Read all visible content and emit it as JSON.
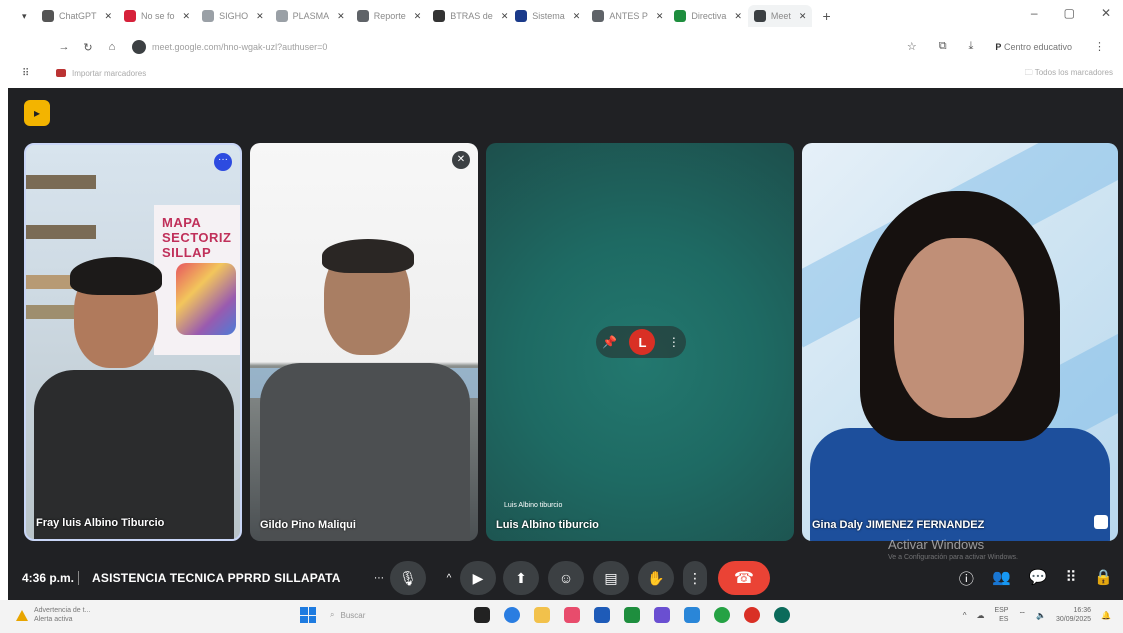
{
  "browser": {
    "tabs": [
      {
        "label": "ChatGPT",
        "color": "#555555"
      },
      {
        "label": "No se fo",
        "color": "#d6213a"
      },
      {
        "label": "SIGHO",
        "color": "#9aa0a6"
      },
      {
        "label": "PLASMA",
        "color": "#9aa0a6"
      },
      {
        "label": "Reporte",
        "color": "#5f6368"
      },
      {
        "label": "BTRAS de",
        "color": "#333333"
      },
      {
        "label": "Sistema",
        "color": "#1a3a8a"
      },
      {
        "label": "ANTES P",
        "color": "#5f6368"
      },
      {
        "label": "Directiva",
        "color": "#1e8e3e"
      },
      {
        "label": "Meet",
        "color": "#3c4043"
      }
    ],
    "url": "meet.google.com/hno-wgak-uzl?authuser=0",
    "profile_label": "Centro educativo",
    "bookmark_label": "Importar marcadores",
    "all_bookmarks_label": "Todos los marcadores"
  },
  "meet": {
    "participants": [
      {
        "name": "Fray luis Albino Tiburcio"
      },
      {
        "name": "Gildo Pino Maliqui"
      },
      {
        "name": "Luis Albino tiburcio",
        "subname": "Luis Albino tiburcio",
        "initial": "L"
      },
      {
        "name": "Gina Daly JIMENEZ FERNANDEZ"
      }
    ],
    "poster_text": [
      "MAPA",
      "SECTORIZ",
      "SILLAP"
    ],
    "time": "4:36 p.m.",
    "meeting_title": "ASISTENCIA TECNICA PPRRD SILLAPATA",
    "watermark": "Activar Windows",
    "watermark_sub": "Ve a Configuración para activar Windows."
  },
  "taskbar": {
    "weather_title": "Advertencia de t...",
    "weather_sub": "Alerta activa",
    "search_placeholder": "Buscar",
    "lang_top": "ESP",
    "lang_bottom": "ES",
    "clock_time": "16:36",
    "clock_date": "30/09/2025"
  }
}
